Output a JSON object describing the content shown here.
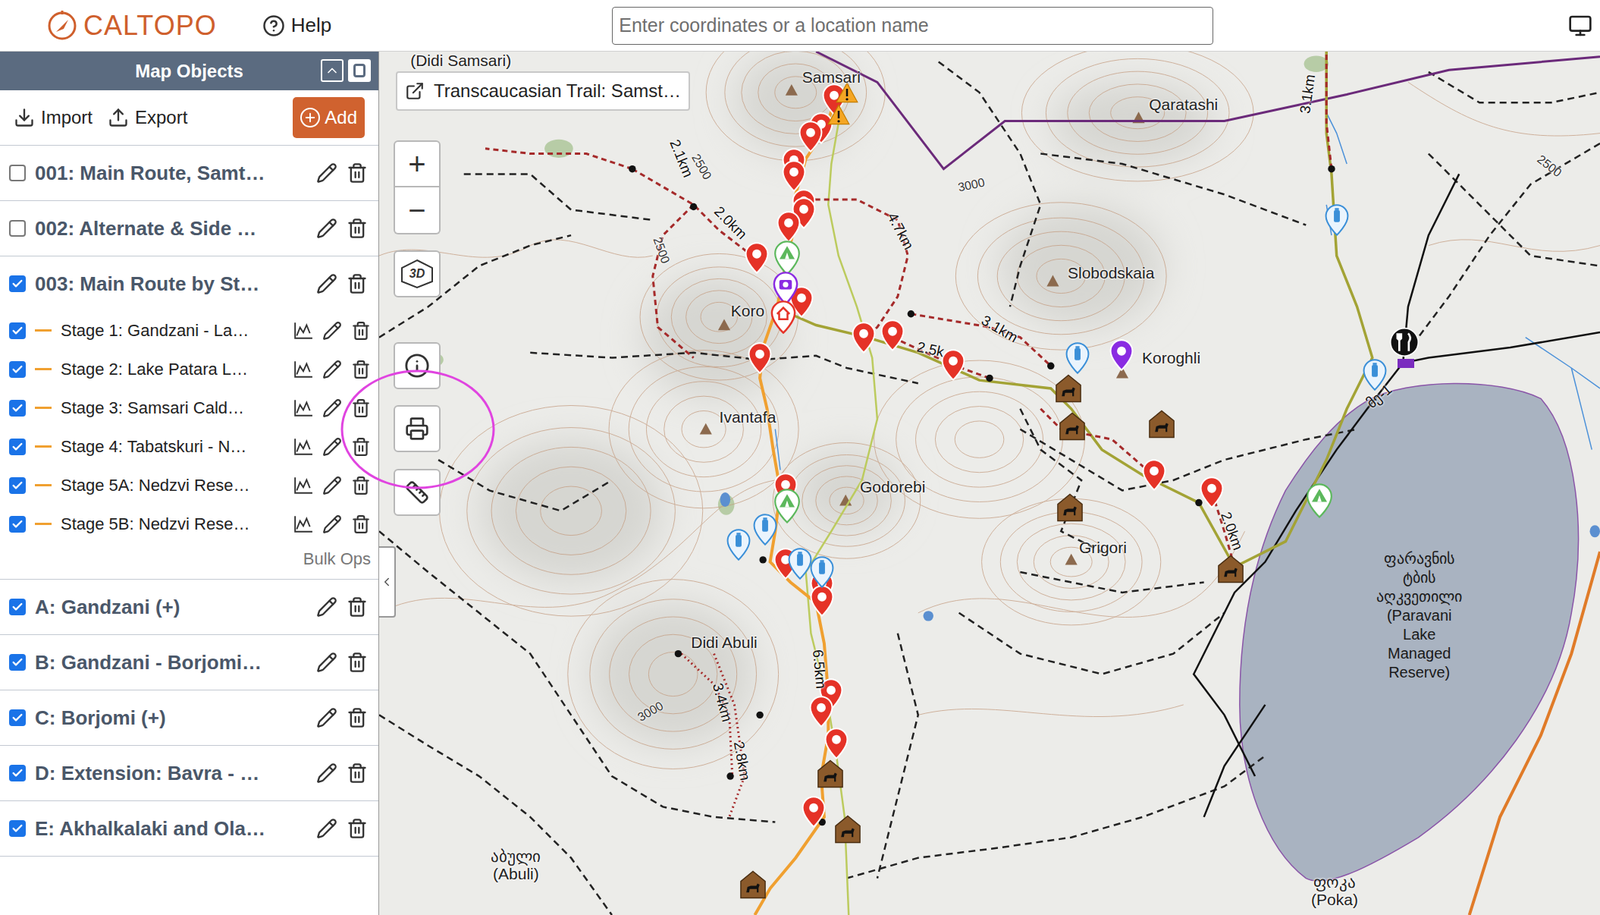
{
  "app": {
    "logo": "CALTOPO",
    "help": "Help",
    "search": {
      "placeholder": "Enter coordinates or a location name"
    }
  },
  "sidebar": {
    "title": "Map Objects",
    "import": "Import",
    "export": "Export",
    "add": "Add",
    "folders": [
      {
        "label": "001: Main Route, Samt…",
        "checked": false,
        "children": []
      },
      {
        "label": "002: Alternate & Side …",
        "checked": false,
        "children": []
      },
      {
        "label": "003: Main Route by St…",
        "checked": true,
        "footer": "Bulk Ops",
        "children": [
          {
            "label": "Stage 1: Gandzani - La…",
            "checked": true
          },
          {
            "label": "Stage 2: Lake Patara L…",
            "checked": true
          },
          {
            "label": "Stage 3: Samsari Cald…",
            "checked": true
          },
          {
            "label": "Stage 4: Tabatskuri - N…",
            "checked": true
          },
          {
            "label": "Stage 5A: Nedzvi Rese…",
            "checked": true
          },
          {
            "label": "Stage 5B: Nedzvi Rese…",
            "checked": true
          }
        ]
      },
      {
        "label": "A: Gandzani (+)",
        "checked": true,
        "children": []
      },
      {
        "label": "B: Gandzani - Borjomi…",
        "checked": true,
        "children": []
      },
      {
        "label": "C: Borjomi (+)",
        "checked": true,
        "children": []
      },
      {
        "label": "D: Extension: Bavra - …",
        "checked": true,
        "children": []
      },
      {
        "label": "E: Akhalkalaki and Ola…",
        "checked": true,
        "children": []
      }
    ]
  },
  "map": {
    "title": "Transcaucasian Trail: Samst…",
    "controls": {
      "zoom_in": "+",
      "zoom_out": "−",
      "three_d": "3D"
    },
    "place_labels": [
      "(Didi Samsari)",
      "Samsari",
      "Qaratashi",
      "Koro",
      "Slobodskaia",
      "Koroghli",
      "Ivantafa",
      "Godorebi",
      "Grigori",
      "Didi Abuli",
      "აბული",
      "(Abuli)",
      "ფოკა",
      "(Poka)"
    ],
    "lake_label": [
      "ფარავნის",
      "ტბის",
      "აღკვეთილი",
      "(Paravani",
      "Lake",
      "Managed",
      "Reserve)"
    ],
    "distance_labels": [
      "2.1km",
      "2.0km",
      "4.7km",
      "2.5k",
      "3.1km",
      "3.1km",
      "2.0km",
      "6.5km",
      "3.4km",
      "2.8km",
      "მე-1"
    ],
    "contour_labels": [
      "2500",
      "2500",
      "3000",
      "2500",
      "3000"
    ]
  }
}
